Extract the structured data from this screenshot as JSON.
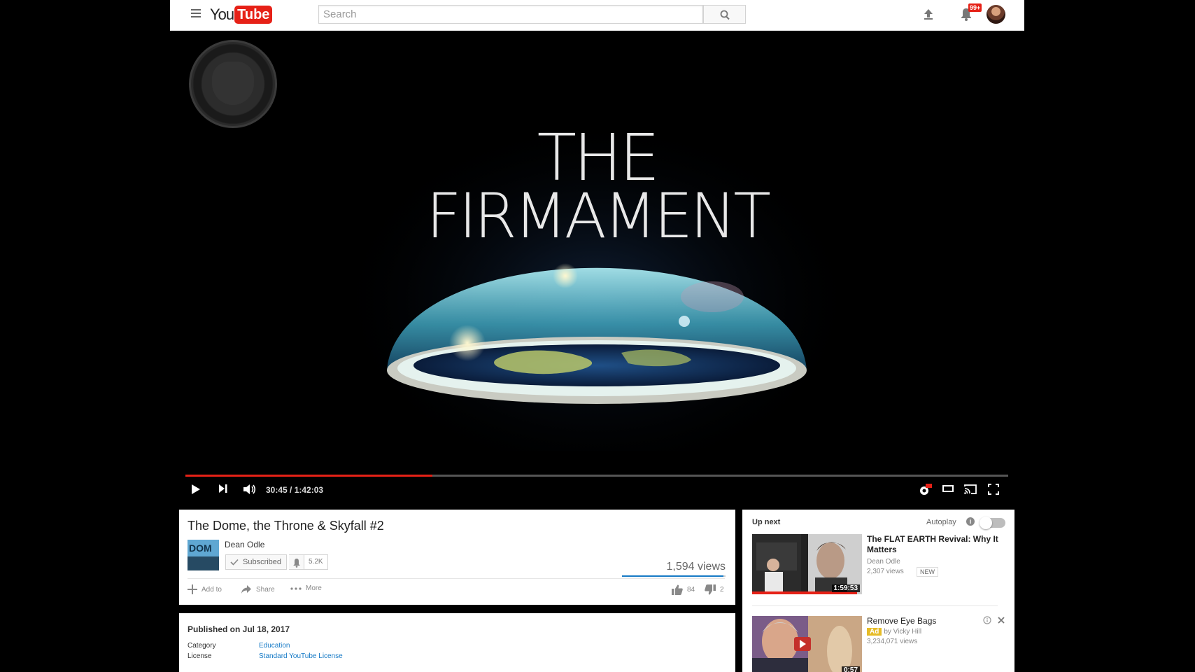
{
  "header": {
    "logo_you": "You",
    "logo_tube": "Tube",
    "search_placeholder": "Search",
    "notifications_badge": "99+"
  },
  "player": {
    "video_title_line1": "THE",
    "video_title_line2": "FIRMAMENT",
    "current_time": "30:45",
    "duration": "1:42:03",
    "time_display": "30:45 / 1:42:03",
    "progress_fraction": 0.3,
    "hd_badge": "HD"
  },
  "video": {
    "title": "The Dome, the Throne & Skyfall #2",
    "channel_name": "Dean Odle",
    "channel_thumb_text": "DOM",
    "subscribed_label": "Subscribed",
    "subscriber_count": "5.2K",
    "view_count": "1,594 views",
    "likes": "84",
    "dislikes": "2",
    "like_ratio": 0.977,
    "actions": {
      "add_to": "Add to",
      "share": "Share",
      "more": "More"
    }
  },
  "description": {
    "published": "Published on Jul 18, 2017",
    "category_label": "Category",
    "category_value": "Education",
    "license_label": "License",
    "license_value": "Standard YouTube License"
  },
  "sidebar": {
    "up_next_label": "Up next",
    "autoplay_label": "Autoplay",
    "autoplay_on": false,
    "videos": [
      {
        "title": "The FLAT EARTH Revival: Why It Matters",
        "channel": "Dean Odle",
        "views": "2,307 views",
        "badge": "NEW",
        "duration": "1:59:53"
      },
      {
        "title": "Remove Eye Bags",
        "ad_label": "Ad",
        "channel": "by Vicky Hill",
        "views": "3,234,071 views",
        "duration": "0:57"
      }
    ]
  },
  "colors": {
    "brand_red": "#e62117",
    "link_blue": "#167ac6",
    "ad_yellow": "#e6bc27"
  },
  "icons": [
    "menu-icon",
    "search-icon",
    "upload-icon",
    "bell-icon",
    "play-icon",
    "next-icon",
    "volume-icon",
    "settings-icon",
    "theater-icon",
    "cast-icon",
    "fullscreen-icon",
    "plus-icon",
    "share-icon",
    "more-icon",
    "thumbs-up-icon",
    "thumbs-down-icon",
    "check-icon",
    "info-icon",
    "close-icon"
  ]
}
